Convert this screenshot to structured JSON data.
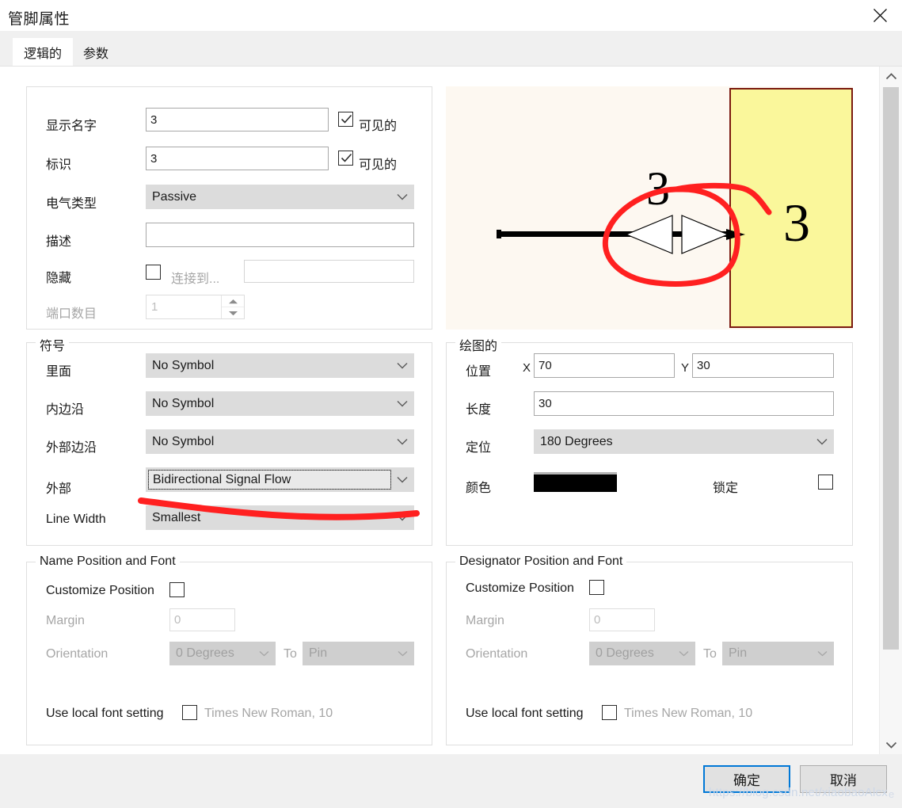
{
  "window": {
    "title": "管脚属性",
    "close_icon": "close-icon"
  },
  "tabs": [
    {
      "label": "逻辑的",
      "active": true
    },
    {
      "label": "参数",
      "active": false
    }
  ],
  "logical": {
    "display_name": {
      "label": "显示名字",
      "value": "3",
      "visible_label": "可见的",
      "visible_checked": true
    },
    "designator": {
      "label": "标识",
      "value": "3",
      "visible_label": "可见的",
      "visible_checked": true
    },
    "electrical_type": {
      "label": "电气类型",
      "value": "Passive"
    },
    "description": {
      "label": "描述",
      "value": ""
    },
    "hide": {
      "label": "隐藏",
      "checked": false,
      "connect_to_label": "连接到...",
      "connect_to_value": ""
    },
    "port_count": {
      "label": "端口数目",
      "value": "1",
      "disabled": true
    }
  },
  "symbol": {
    "legend": "符号",
    "inside": {
      "label": "里面",
      "value": "No Symbol"
    },
    "inside_edge": {
      "label": "内边沿",
      "value": "No Symbol"
    },
    "outside_edge": {
      "label": "外部边沿",
      "value": "No Symbol"
    },
    "outside": {
      "label": "外部",
      "value": "Bidirectional Signal Flow",
      "focused": true
    },
    "line_width": {
      "label": "Line Width",
      "value": "Smallest"
    }
  },
  "graphical": {
    "legend": "绘图的",
    "location": {
      "label": "位置",
      "x_label": "X",
      "x_value": "70",
      "y_label": "Y",
      "y_value": "30"
    },
    "length": {
      "label": "长度",
      "value": "30"
    },
    "orientation": {
      "label": "定位",
      "value": "180 Degrees"
    },
    "color": {
      "label": "颜色",
      "value": "#000000"
    },
    "locked": {
      "label": "锁定",
      "checked": false
    }
  },
  "name_position": {
    "legend": "Name Position and Font",
    "customize_position": {
      "label": "Customize Position",
      "checked": false
    },
    "margin": {
      "label": "Margin",
      "value": "0"
    },
    "orientation": {
      "label": "Orientation",
      "value": "0 Degrees",
      "to_label": "To",
      "to_value": "Pin"
    },
    "use_local_font": {
      "label": "Use local font setting",
      "checked": false,
      "font_text": "Times New Roman, 10"
    }
  },
  "designator_position": {
    "legend": "Designator Position and Font",
    "customize_position": {
      "label": "Customize Position",
      "checked": false
    },
    "margin": {
      "label": "Margin",
      "value": "0"
    },
    "orientation": {
      "label": "Orientation",
      "value": "0 Degrees",
      "to_label": "To",
      "to_value": "Pin"
    },
    "use_local_font": {
      "label": "Use local font setting",
      "checked": false,
      "font_text": "Times New Roman, 10"
    }
  },
  "preview": {
    "pin_name": "3",
    "pin_designator": "3",
    "background_color": "#fdf8f1",
    "body_color": "#faf79b",
    "body_border_color": "#7b1a10",
    "wire_color": "#000000",
    "annotation_color": "#ff2020"
  },
  "footer": {
    "ok_label": "确定",
    "cancel_label": "取消"
  },
  "watermark": {
    "text": "https://blog.csdn.net/xiaobaoAlcx",
    "suffix": "e"
  },
  "scrollbar": {
    "up_icon": "chevron-up-icon",
    "down_icon": "chevron-down-icon"
  }
}
